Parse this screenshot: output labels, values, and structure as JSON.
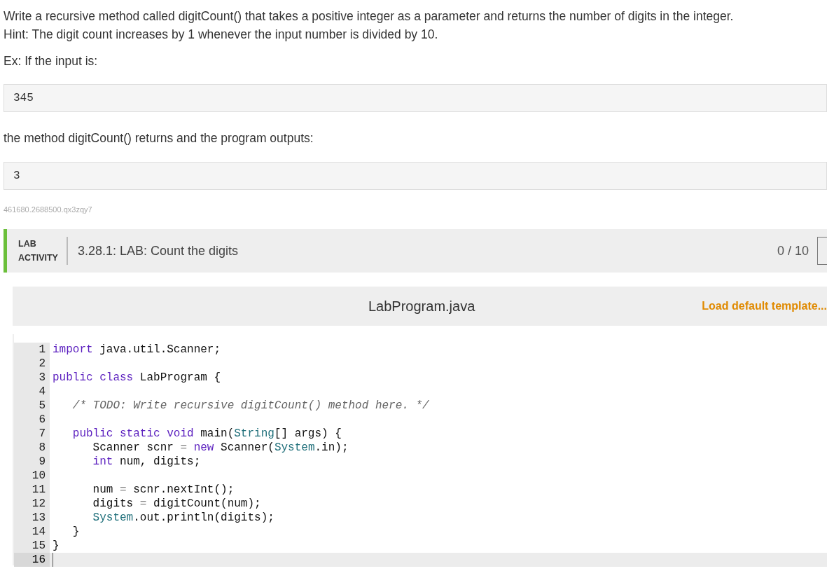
{
  "instructions": {
    "lines": [
      "Write a recursive method called digitCount() that takes a positive integer as a parameter and returns the number of digits in the integer.",
      "Hint: The digit count increases by 1 whenever the input number is divided by 10."
    ],
    "example_intro": "Ex: If the input is:",
    "example_input": "345",
    "output_intro": "the method digitCount() returns and the program outputs:",
    "example_output": "3",
    "id_code": "461680.2688500.qx3zqy7"
  },
  "lab_header": {
    "label_lines": [
      "LAB",
      "ACTIVITY"
    ],
    "title": "3.28.1: LAB: Count the digits",
    "score": "0 / 10"
  },
  "editor": {
    "filename": "LabProgram.java",
    "template_link": "Load default template...",
    "lines": [
      {
        "number": "1",
        "current": false,
        "tokens": [
          {
            "kind": "keyword",
            "text": "import"
          },
          {
            "kind": "plain",
            "text": " java.util.Scanner;"
          }
        ]
      },
      {
        "number": "2",
        "current": false
      },
      {
        "number": "3",
        "current": false,
        "tokens": [
          {
            "kind": "keyword",
            "text": "public class"
          },
          {
            "kind": "plain",
            "text": " LabProgram {"
          }
        ]
      },
      {
        "number": "4",
        "current": false
      },
      {
        "number": "5",
        "current": false,
        "tokens": [
          {
            "kind": "comment",
            "text": "   /* TODO: Write recursive digitCount() method here. */"
          }
        ]
      },
      {
        "number": "6",
        "current": false
      },
      {
        "number": "7",
        "current": false,
        "tokens": [
          {
            "kind": "keyword",
            "text": "   public static void"
          },
          {
            "kind": "plain",
            "text": " main("
          },
          {
            "kind": "type",
            "text": "String"
          },
          {
            "kind": "plain",
            "text": "[] args) {"
          }
        ]
      },
      {
        "number": "8",
        "current": false,
        "tokens": [
          {
            "kind": "plain",
            "text": "      Scanner scnr "
          },
          {
            "kind": "operator",
            "text": "="
          },
          {
            "kind": "keyword",
            "text": " new"
          },
          {
            "kind": "plain",
            "text": " Scanner("
          },
          {
            "kind": "type",
            "text": "System"
          },
          {
            "kind": "plain",
            "text": ".in);"
          }
        ]
      },
      {
        "number": "9",
        "current": false,
        "tokens": [
          {
            "kind": "keyword",
            "text": "      int"
          },
          {
            "kind": "plain",
            "text": " num, digits;"
          }
        ]
      },
      {
        "number": "10",
        "current": false
      },
      {
        "number": "11",
        "current": false,
        "tokens": [
          {
            "kind": "plain",
            "text": "      num "
          },
          {
            "kind": "operator",
            "text": "="
          },
          {
            "kind": "plain",
            "text": " scnr.nextInt();"
          }
        ]
      },
      {
        "number": "12",
        "current": false,
        "tokens": [
          {
            "kind": "plain",
            "text": "      digits "
          },
          {
            "kind": "operator",
            "text": "="
          },
          {
            "kind": "plain",
            "text": " digitCount(num);"
          }
        ]
      },
      {
        "number": "13",
        "current": false,
        "tokens": [
          {
            "kind": "type",
            "text": "      System"
          },
          {
            "kind": "plain",
            "text": ".out.println(digits);"
          }
        ]
      },
      {
        "number": "14",
        "current": false,
        "tokens": [
          {
            "kind": "plain",
            "text": "   }"
          }
        ]
      },
      {
        "number": "15",
        "current": false,
        "tokens": [
          {
            "kind": "plain",
            "text": "}"
          }
        ]
      },
      {
        "number": "16",
        "current": true
      }
    ]
  }
}
